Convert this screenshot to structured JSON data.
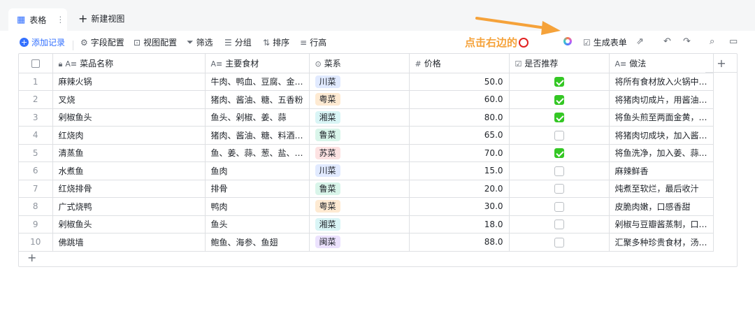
{
  "tabs": {
    "active_label": "表格",
    "more": "⋮",
    "new_view_label": "新建视图"
  },
  "toolbar": {
    "add_record": "添加记录",
    "field_config": "字段配置",
    "view_config": "视图配置",
    "filter": "筛选",
    "group": "分组",
    "sort": "排序",
    "row_height": "行高",
    "generate_form": "生成表单"
  },
  "annotation": {
    "text": "点击右边的",
    "accent": "#f5a23a",
    "ring_color": "#e02020"
  },
  "columns": [
    "菜品名称",
    "主要食材",
    "菜系",
    "价格",
    "是否推荐",
    "做法"
  ],
  "tag_colors": {
    "川菜": {
      "bg": "#e1eaff",
      "fg": "#1f2329"
    },
    "粤菜": {
      "bg": "#feead2",
      "fg": "#1f2329"
    },
    "湘菜": {
      "bg": "#d9f5f6",
      "fg": "#1f2329"
    },
    "鲁菜": {
      "bg": "#d9f5ea",
      "fg": "#1f2329"
    },
    "苏菜": {
      "bg": "#fde2e2",
      "fg": "#1f2329"
    },
    "闽菜": {
      "bg": "#ece2fe",
      "fg": "#1f2329"
    }
  },
  "rows": [
    {
      "idx": "1",
      "name": "麻辣火锅",
      "ingredients": "牛肉、鸭血、豆腐、金…",
      "cuisine": "川菜",
      "price": "50.0",
      "recommended": true,
      "method": "将所有食材放入火锅中…"
    },
    {
      "idx": "2",
      "name": "叉烧",
      "ingredients": "猪肉、酱油、糖、五香粉",
      "cuisine": "粤菜",
      "price": "60.0",
      "recommended": true,
      "method": "将猪肉切成片，用酱油…"
    },
    {
      "idx": "3",
      "name": "剁椒鱼头",
      "ingredients": "鱼头、剁椒、姜、蒜",
      "cuisine": "湘菜",
      "price": "80.0",
      "recommended": true,
      "method": "将鱼头煎至两面金黄，…"
    },
    {
      "idx": "4",
      "name": "红烧肉",
      "ingredients": "猪肉、酱油、糖、料酒…",
      "cuisine": "鲁菜",
      "price": "65.0",
      "recommended": false,
      "method": "将猪肉切成块，加入酱…"
    },
    {
      "idx": "5",
      "name": "清蒸鱼",
      "ingredients": "鱼、姜、蒜、葱、盐、…",
      "cuisine": "苏菜",
      "price": "70.0",
      "recommended": true,
      "method": "将鱼洗净，加入姜、蒜…"
    },
    {
      "idx": "6",
      "name": "水煮鱼",
      "ingredients": "鱼肉",
      "cuisine": "川菜",
      "price": "15.0",
      "recommended": false,
      "method": "麻辣鲜香"
    },
    {
      "idx": "7",
      "name": "红烧排骨",
      "ingredients": "排骨",
      "cuisine": "鲁菜",
      "price": "20.0",
      "recommended": false,
      "method": "炖煮至软烂，最后收汁"
    },
    {
      "idx": "8",
      "name": "广式烧鸭",
      "ingredients": "鸭肉",
      "cuisine": "粤菜",
      "price": "30.0",
      "recommended": false,
      "method": "皮脆肉嫩，口感香甜"
    },
    {
      "idx": "9",
      "name": "剁椒鱼头",
      "ingredients": "鱼头",
      "cuisine": "湘菜",
      "price": "18.0",
      "recommended": false,
      "method": "剁椒与豆瓣酱蒸制，口…"
    },
    {
      "idx": "10",
      "name": "佛跳墙",
      "ingredients": "鲍鱼、海参、鱼翅",
      "cuisine": "闽菜",
      "price": "88.0",
      "recommended": false,
      "method": "汇聚多种珍贵食材，汤…"
    }
  ]
}
